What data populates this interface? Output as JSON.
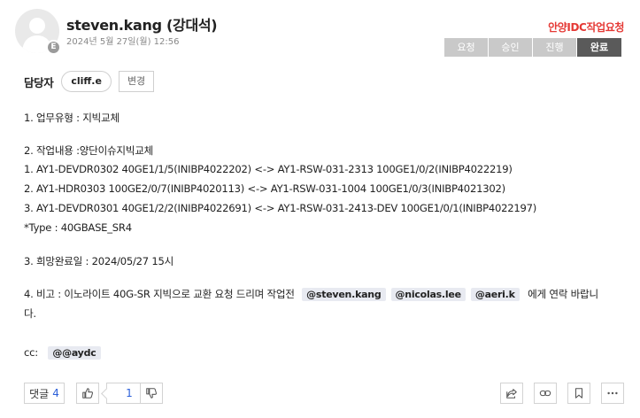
{
  "author": {
    "name": "steven.kang (강대석)",
    "date": "2024년 5월 27일(월) 12:56",
    "badge": "E"
  },
  "board_title": "안양IDC작업요청",
  "steps": [
    "요청",
    "승인",
    "진행",
    "완료"
  ],
  "active_step": "완료",
  "assignee": {
    "label": "담당자",
    "name": "cliff.e",
    "change_label": "변경"
  },
  "body": {
    "line1": "1. 업무유형 : 지빅교체",
    "line2": "2. 작업내용 :양단이슈지빅교체",
    "line3": "1. AY1-DEVDR0302 40GE1/1/5(INIBP4022202) <-> AY1-RSW-031-2313 100GE1/0/2(INIBP4022219)",
    "line4": "2. AY1-HDR0303 100GE2/0/7(INIBP4020113) <-> AY1-RSW-031-1004 100GE1/0/3(INIBP4021302)",
    "line5": "3. AY1-DEVDR0301 40GE1/2/2(INIBP4022691) <-> AY1-RSW-031-2413-DEV 100GE1/0/1(INIBP4022197)",
    "line6": "*Type : 40GBASE_SR4",
    "line7": "3. 희망완료일 : 2024/05/27 15시",
    "line8_prefix": "4. 비고 : 이노라이트 40G-SR 지빅으로 교환 요청 드리며 작업전",
    "mentions": [
      "@steven.kang",
      "@nicolas.lee",
      "@aeri.k"
    ],
    "line8_suffix": "에게 연락 바랍니",
    "line9": "다.",
    "cc_label": "cc:",
    "cc_mention": "@@aydc"
  },
  "footer": {
    "reply_label": "댓글",
    "reply_count": "4",
    "like_count": "1"
  },
  "icons": {
    "like": "thumbs-up-icon",
    "dislike": "thumbs-down-icon",
    "share": "share-icon",
    "link": "link-icon",
    "bookmark": "bookmark-icon",
    "more": "more-icon"
  },
  "colors": {
    "board_title": "#e53935",
    "step_active": "#5a5a5a",
    "step_inactive": "#c9c9c9",
    "count": "#2b5fd9",
    "mention_bg": "#e8eaf1"
  }
}
